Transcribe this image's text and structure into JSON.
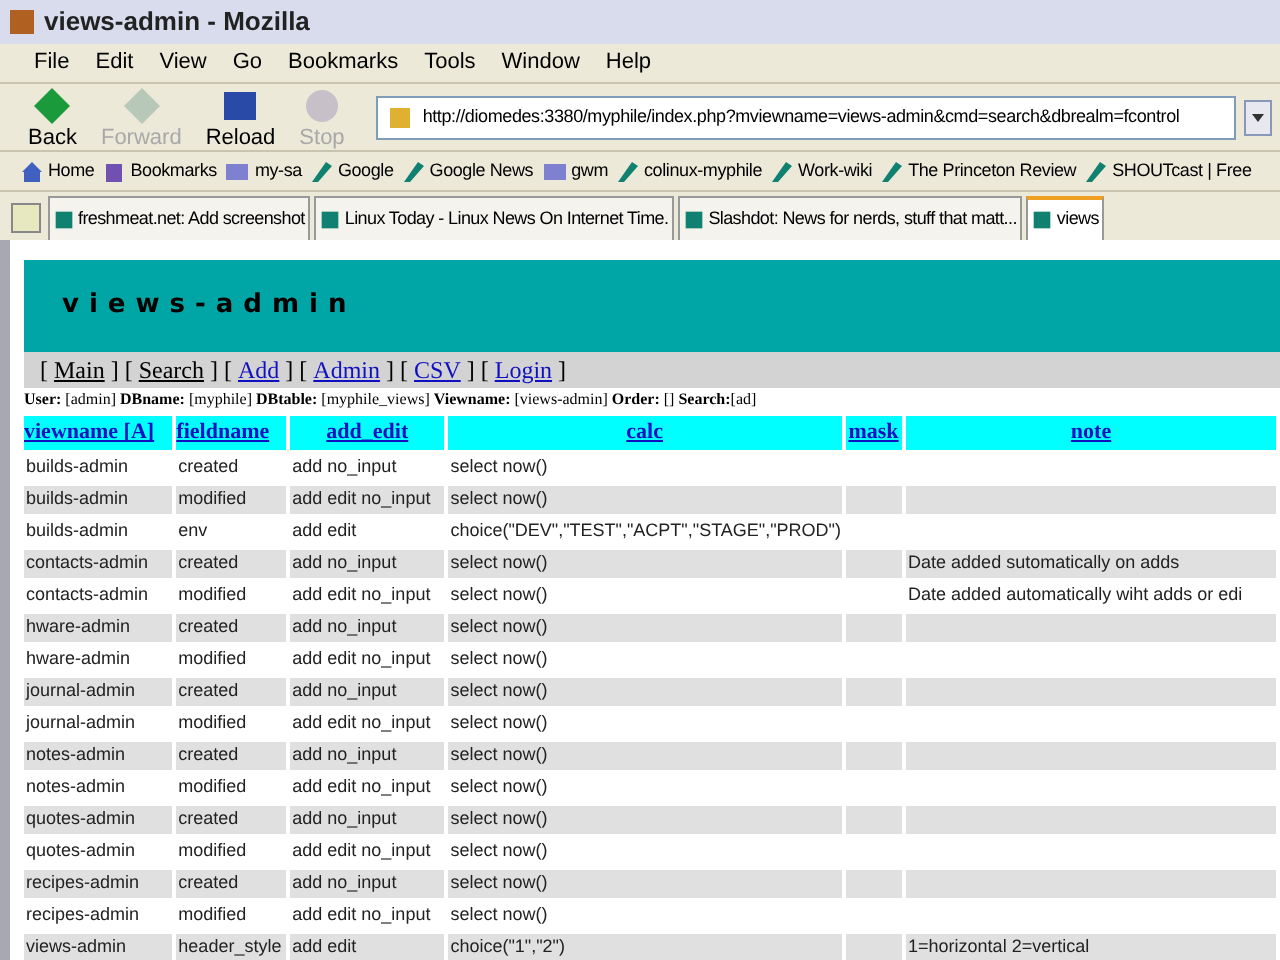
{
  "window": {
    "title": "views-admin - Mozilla"
  },
  "menu": [
    "File",
    "Edit",
    "View",
    "Go",
    "Bookmarks",
    "Tools",
    "Window",
    "Help"
  ],
  "nav_buttons": [
    {
      "label": "Back",
      "kind": "back",
      "disabled": false
    },
    {
      "label": "Forward",
      "kind": "forward",
      "disabled": true
    },
    {
      "label": "Reload",
      "kind": "reload",
      "disabled": false
    },
    {
      "label": "Stop",
      "kind": "stop",
      "disabled": true
    }
  ],
  "url": "http://diomedes:3380/myphile/index.php?mviewname=views-admin&cmd=search&dbrealm=fcontrol",
  "bookmarks": [
    {
      "label": "Home",
      "kind": "home"
    },
    {
      "label": "Bookmarks",
      "kind": "bookmarks"
    },
    {
      "label": "my-sa",
      "kind": "folder"
    },
    {
      "label": "Google",
      "kind": "link"
    },
    {
      "label": "Google News",
      "kind": "link"
    },
    {
      "label": "gwm",
      "kind": "folder"
    },
    {
      "label": "colinux-myphile",
      "kind": "link"
    },
    {
      "label": "Work-wiki",
      "kind": "link"
    },
    {
      "label": "The Princeton Review",
      "kind": "link"
    },
    {
      "label": "SHOUTcast | Free",
      "kind": "link"
    }
  ],
  "tabs": [
    {
      "label": "freshmeat.net: Add screenshot",
      "selected": false
    },
    {
      "label": "Linux Today - Linux News On Internet Time.",
      "selected": false
    },
    {
      "label": "Slashdot: News for nerds, stuff that matt...",
      "selected": false
    },
    {
      "label": "views",
      "selected": true
    }
  ],
  "page": {
    "banner": "views-admin",
    "links": [
      {
        "open": "[",
        "label": "Main",
        "close": "]"
      },
      {
        "open": "[",
        "label": "Search",
        "close": "]"
      },
      {
        "open": "[",
        "label": "Add",
        "close": "]"
      },
      {
        "open": "[",
        "label": "Admin",
        "close": "]"
      },
      {
        "open": "[",
        "label": "CSV",
        "close": "]"
      },
      {
        "open": "[",
        "label": "Login",
        "close": "]"
      }
    ],
    "info": "**User:** [admin] **DBname:** [myphile] **DBtable:** [myphile_views] **Viewname:** [views-admin] **Order:** [] **Search:**[ad]",
    "table": {
      "columns": [
        "viewname [A]",
        "fieldname",
        "add_edit",
        "calc",
        "mask",
        "note"
      ],
      "rows": [
        [
          "builds-admin",
          "created",
          "add no_input",
          "select now()",
          "",
          ""
        ],
        [
          "builds-admin",
          "modified",
          "add edit no_input",
          "select now()",
          "",
          ""
        ],
        [
          "builds-admin",
          "env",
          "add edit",
          "choice(\"DEV\",\"TEST\",\"ACPT\",\"STAGE\",\"PROD\")",
          "",
          ""
        ],
        [
          "contacts-admin",
          "created",
          "add no_input",
          "select now()",
          "",
          "Date added sutomatically on adds"
        ],
        [
          "contacts-admin",
          "modified",
          "add edit no_input",
          "select now()",
          "",
          "Date added automatically wiht adds or edi"
        ],
        [
          "hware-admin",
          "created",
          "add no_input",
          "select now()",
          "",
          ""
        ],
        [
          "hware-admin",
          "modified",
          "add edit no_input",
          "select now()",
          "",
          ""
        ],
        [
          "journal-admin",
          "created",
          "add no_input",
          "select now()",
          "",
          ""
        ],
        [
          "journal-admin",
          "modified",
          "add edit no_input",
          "select now()",
          "",
          ""
        ],
        [
          "notes-admin",
          "created",
          "add no_input",
          "select now()",
          "",
          ""
        ],
        [
          "notes-admin",
          "modified",
          "add edit no_input",
          "select now()",
          "",
          ""
        ],
        [
          "quotes-admin",
          "created",
          "add no_input",
          "select now()",
          "",
          ""
        ],
        [
          "quotes-admin",
          "modified",
          "add edit no_input",
          "select now()",
          "",
          ""
        ],
        [
          "recipes-admin",
          "created",
          "add no_input",
          "select now()",
          "",
          ""
        ],
        [
          "recipes-admin",
          "modified",
          "add edit no_input",
          "select now()",
          "",
          ""
        ],
        [
          "views-admin",
          "header_style",
          "add edit",
          "choice(\"1\",\"2\")",
          "",
          "1=horizontal 2=vertical"
        ]
      ]
    }
  }
}
